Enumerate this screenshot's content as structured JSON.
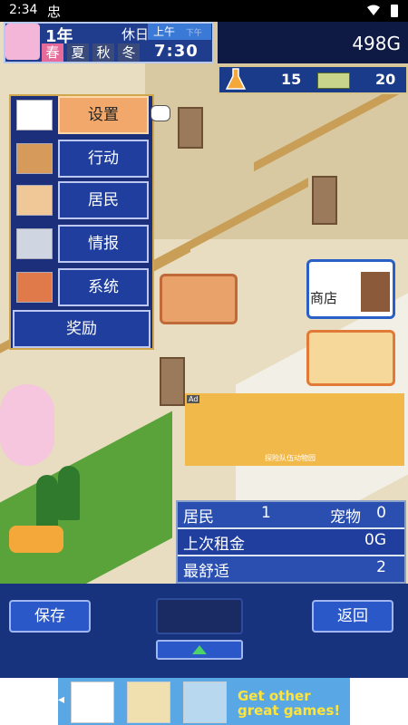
{
  "status_bar": {
    "time": "2:34",
    "app_icon_glyph": "忠"
  },
  "hud": {
    "year": "1年",
    "rest_day": "休日",
    "ampm": "上午",
    "ampm_alt": "下午",
    "clock": "7:30",
    "seasons": [
      "春",
      "夏",
      "秋",
      "冬"
    ],
    "money": "498G",
    "resource_research": "15",
    "resource_tickets": "20"
  },
  "menu": {
    "items": [
      {
        "label": "设置",
        "icon": "building-icon",
        "active": true
      },
      {
        "label": "行动",
        "icon": "suitcase-icon",
        "active": false
      },
      {
        "label": "居民",
        "icon": "residents-icon",
        "active": false
      },
      {
        "label": "情报",
        "icon": "computer-icon",
        "active": false
      },
      {
        "label": "系统",
        "icon": "toolbox-icon",
        "active": false
      }
    ],
    "reward_label": "奖励"
  },
  "shop": {
    "label": "商店"
  },
  "ad": {
    "label": "Ad",
    "caption": "探险队伍动物园"
  },
  "stats": {
    "residents_label": "居民",
    "residents_value": "1",
    "pets_label": "宠物",
    "pets_value": "0",
    "last_rent_label": "上次租金",
    "last_rent_value": "0G",
    "comfort_label": "最舒适",
    "comfort_value": "2"
  },
  "bottom": {
    "save_label": "保存",
    "back_label": "返回"
  },
  "ad_bar": {
    "text": "Get other great games!"
  },
  "colors": {
    "accent": "#1f3e9e",
    "active_menu": "#f1a86a",
    "gold": "#ffe43a"
  }
}
